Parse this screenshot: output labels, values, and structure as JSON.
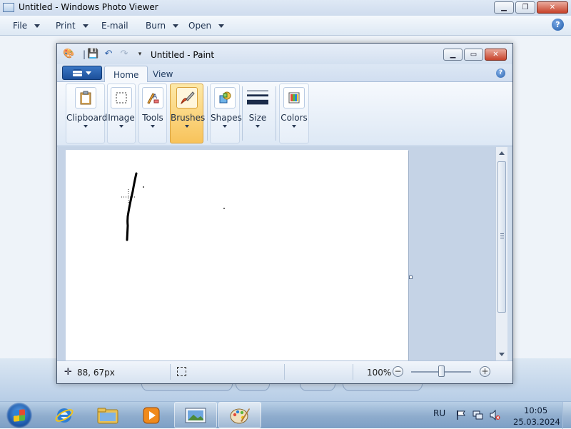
{
  "photo_viewer": {
    "title": "Untitled - Windows Photo Viewer",
    "menu": {
      "file": "File",
      "print": "Print",
      "email": "E-mail",
      "burn": "Burn",
      "open": "Open"
    },
    "help_label": "?"
  },
  "paint": {
    "title": "Untitled - Paint",
    "tabs": {
      "home": "Home",
      "view": "View"
    },
    "help_label": "?",
    "ribbon": {
      "clipboard": "Clipboard",
      "image": "Image",
      "tools": "Tools",
      "brushes": "Brushes",
      "shapes": "Shapes",
      "size": "Size",
      "colors": "Colors"
    },
    "status": {
      "cursor_position": "88, 67px",
      "zoom": "100%",
      "zoom_out": "−",
      "zoom_in": "+"
    },
    "selected_tool": "brushes",
    "accent_color": "#f8c35b"
  },
  "taskbar": {
    "language": "RU",
    "time": "10:05",
    "date": "25.03.2024",
    "items": [
      "start-button",
      "internet-explorer",
      "windows-explorer",
      "windows-media-player",
      "windows-photo-viewer",
      "paint"
    ]
  }
}
